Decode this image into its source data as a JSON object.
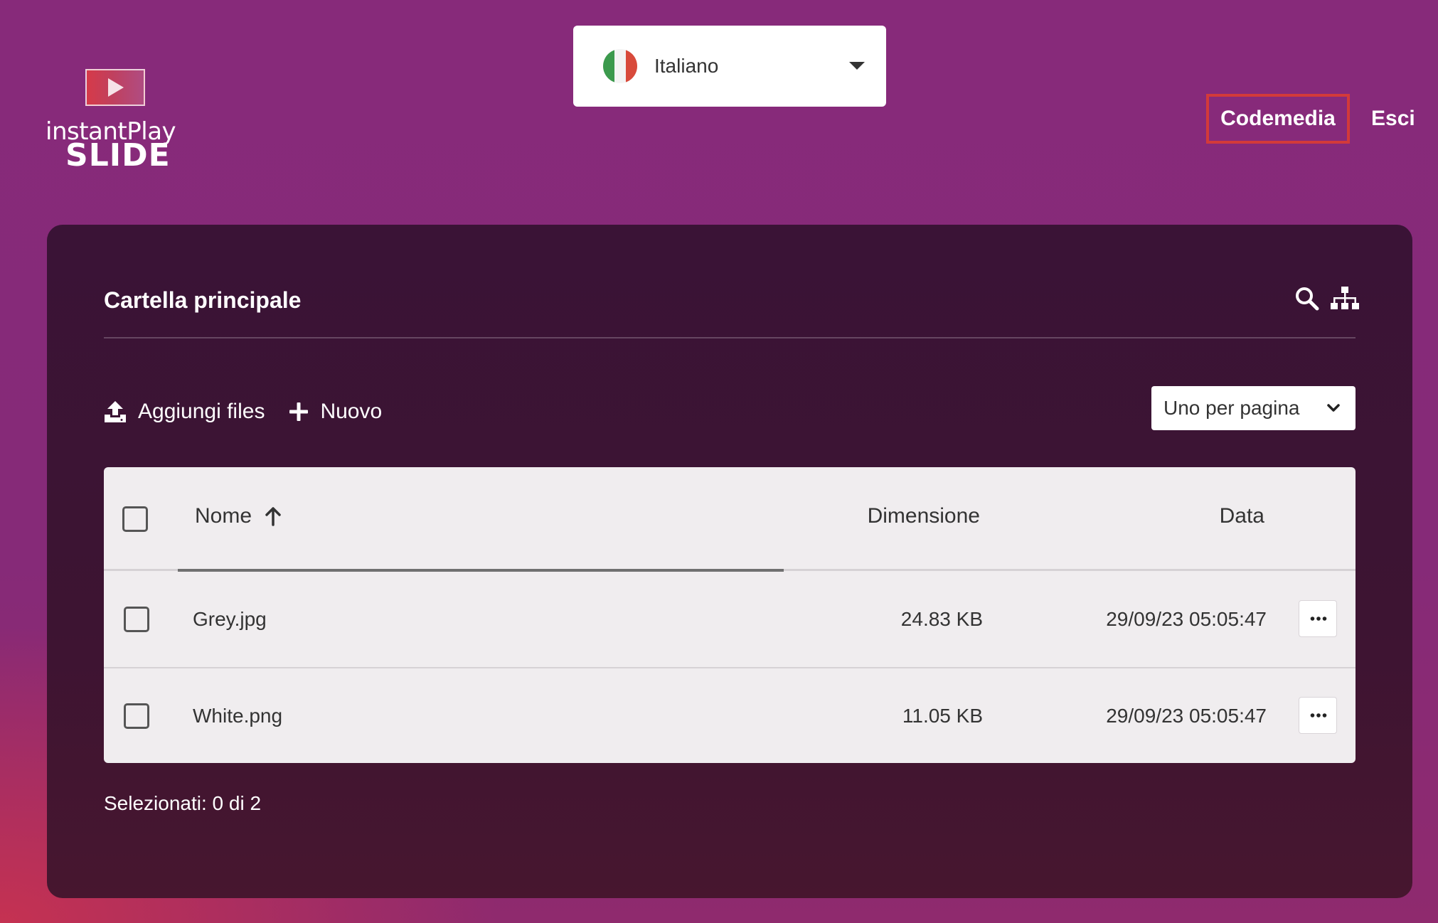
{
  "app": {
    "logo_text_top": "instantPlay",
    "logo_text_bottom": "SLIDE"
  },
  "language": {
    "selected": "Italiano",
    "flag_icon": "italy-flag-icon",
    "flag_colors": [
      "#3c9a4d",
      "#f4f4f4",
      "#d84a3b"
    ]
  },
  "header": {
    "user_label": "Codemedia",
    "logout_label": "Esci",
    "highlight_color": "#d33a3a"
  },
  "panel": {
    "title": "Cartella principale",
    "icons": [
      "search-icon",
      "sitemap-icon"
    ]
  },
  "toolbar": {
    "upload_label": "Aggiungi files",
    "new_label": "Nuovo",
    "per_page_selected": "Uno per pagina"
  },
  "table": {
    "columns": {
      "name": "Nome",
      "size": "Dimensione",
      "date": "Data"
    },
    "sort": {
      "column": "name",
      "direction": "ascending"
    },
    "rows": [
      {
        "name": "Grey.jpg",
        "size": "24.83 KB",
        "date": "29/09/23 05:05:47"
      },
      {
        "name": "White.png",
        "size": "11.05 KB",
        "date": "29/09/23 05:05:47"
      }
    ]
  },
  "footer": {
    "selection_text": "Selezionati: 0 di 2"
  }
}
